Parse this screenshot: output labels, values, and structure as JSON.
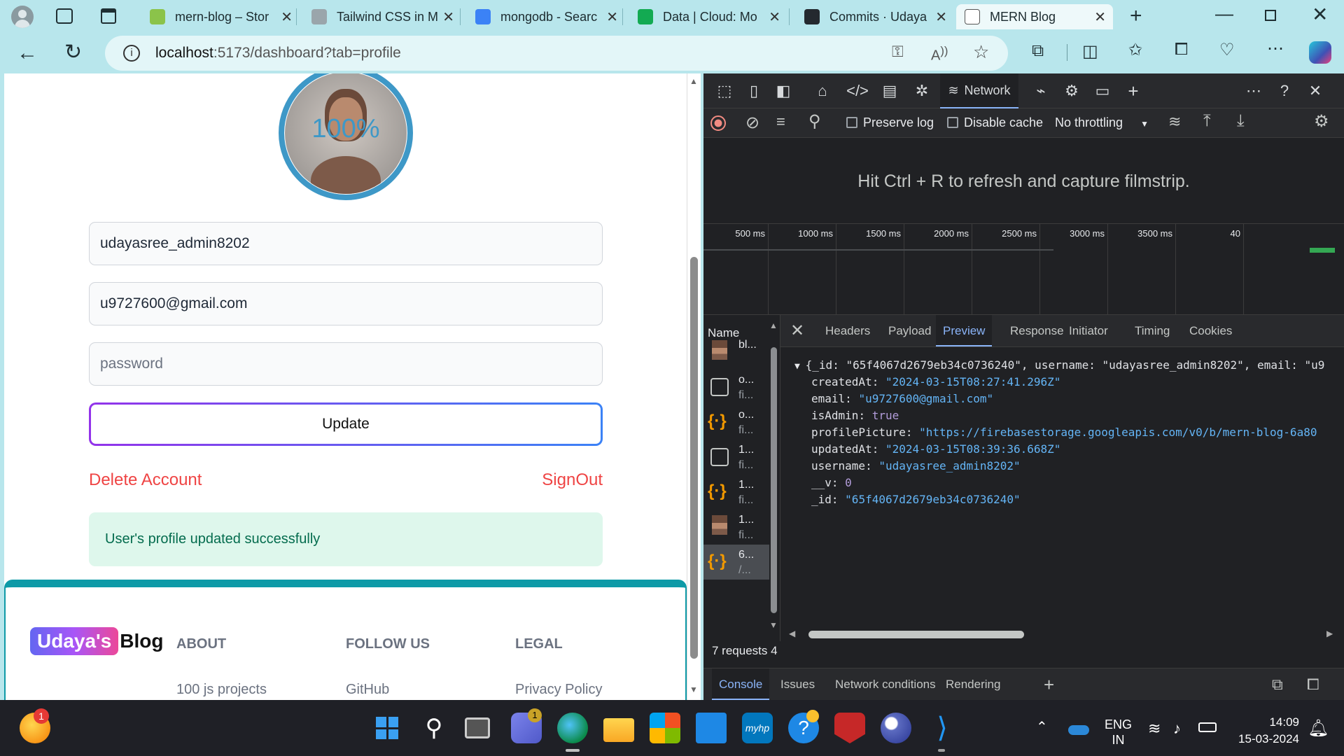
{
  "tabs": [
    {
      "title": "mern-blog – Stor",
      "fav": "#8bc34a"
    },
    {
      "title": "Tailwind CSS in M",
      "fav": "#9aa5ab"
    },
    {
      "title": "mongodb - Searc",
      "fav": "#3b82f6"
    },
    {
      "title": "Data | Cloud: Mo",
      "fav": "#13aa52"
    },
    {
      "title": "Commits · Udaya",
      "fav": "#24292f"
    },
    {
      "title": "MERN Blog",
      "fav": "#ffffff"
    }
  ],
  "address": {
    "url_host": "localhost",
    "url_rest": ":5173/dashboard?tab=profile"
  },
  "profile": {
    "progress_label": "100%",
    "progress": 1.0,
    "username": "udayasree_admin8202",
    "email": "u9727600@gmail.com",
    "password_placeholder": "password",
    "update_label": "Update",
    "delete_label": "Delete Account",
    "signout_label": "SignOut",
    "success_message": "User's profile updated successfully"
  },
  "footer": {
    "logo_highlight": "Udaya's",
    "logo_rest": "Blog",
    "columns": [
      {
        "heading": "ABOUT",
        "link": "100 js projects"
      },
      {
        "heading": "FOLLOW US",
        "link": "GitHub"
      },
      {
        "heading": "LEGAL",
        "link": "Privacy Policy"
      }
    ]
  },
  "devtools": {
    "active_tool": "Network",
    "preserve_log": "Preserve log",
    "disable_cache": "Disable cache",
    "throttling": "No throttling",
    "filmstrip_hint": "Hit Ctrl + R to refresh and capture filmstrip.",
    "timeline_ticks": [
      "500 ms",
      "1000 ms",
      "1500 ms",
      "2000 ms",
      "2500 ms",
      "3000 ms",
      "3500 ms",
      "40"
    ],
    "name_header": "Name",
    "requests": [
      {
        "line1": "bl...",
        "line2": "",
        "kind": "img"
      },
      {
        "line1": "o...",
        "line2": "fi...",
        "kind": "doc"
      },
      {
        "line1": "o...",
        "line2": "fi...",
        "kind": "json"
      },
      {
        "line1": "1...",
        "line2": "fi...",
        "kind": "doc"
      },
      {
        "line1": "1...",
        "line2": "fi...",
        "kind": "json"
      },
      {
        "line1": "1...",
        "line2": "fi...",
        "kind": "img"
      },
      {
        "line1": "6...",
        "line2": "/...",
        "kind": "json"
      }
    ],
    "request_count": "7 requests",
    "request_count_extra": "4",
    "detail_tabs": [
      "Headers",
      "Payload",
      "Preview",
      "Response",
      "Initiator",
      "Timing",
      "Cookies"
    ],
    "active_detail_tab": "Preview",
    "preview_summary": "{_id: \"65f4067d2679eb34c0736240\", username: \"udayasree_admin8202\", email: \"u9",
    "preview_rows": [
      {
        "key": "createdAt",
        "value": "\"2024-03-15T08:27:41.296Z\"",
        "type": "s"
      },
      {
        "key": "email",
        "value": "\"u9727600@gmail.com\"",
        "type": "s"
      },
      {
        "key": "isAdmin",
        "value": "true",
        "type": "b"
      },
      {
        "key": "profilePicture",
        "value": "\"https://firebasestorage.googleapis.com/v0/b/mern-blog-6a80",
        "type": "s"
      },
      {
        "key": "updatedAt",
        "value": "\"2024-03-15T08:39:36.668Z\"",
        "type": "s"
      },
      {
        "key": "username",
        "value": "\"udayasree_admin8202\"",
        "type": "s"
      },
      {
        "key": "__v",
        "value": "0",
        "type": "b"
      },
      {
        "key": "_id",
        "value": "\"65f4067d2679eb34c0736240\"",
        "type": "s"
      }
    ],
    "drawer_tabs": [
      "Console",
      "Issues",
      "Network conditions",
      "Rendering"
    ]
  },
  "taskbar": {
    "lang1": "ENG",
    "lang2": "IN",
    "time": "14:09",
    "date": "15-03-2024",
    "weather_badge": "1",
    "teams_badge": "1"
  }
}
